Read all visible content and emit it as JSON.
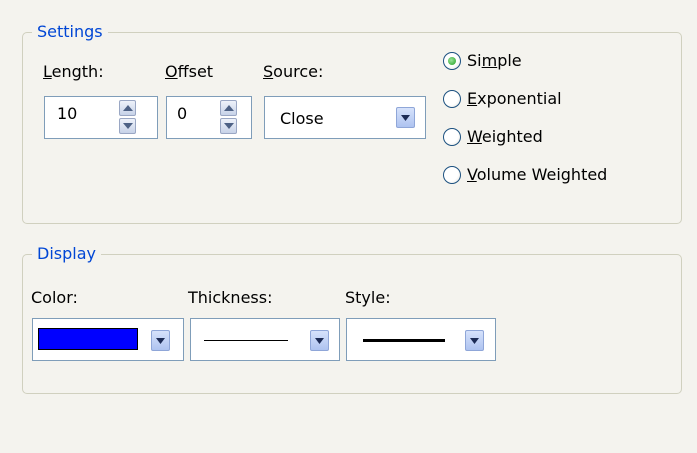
{
  "settings": {
    "title": "Settings",
    "length": {
      "label_pre": "",
      "label_mnemonic": "L",
      "label_post": "ength:",
      "value": "10"
    },
    "offset": {
      "label_pre": "",
      "label_mnemonic": "O",
      "label_post": "ffset",
      "value": "0"
    },
    "source": {
      "label_pre": "",
      "label_mnemonic": "S",
      "label_post": "ource:",
      "value": "Close"
    },
    "methods": [
      {
        "pre": "Si",
        "mnemonic": "m",
        "post": "ple",
        "selected": true
      },
      {
        "pre": "",
        "mnemonic": "E",
        "post": "xponential",
        "selected": false
      },
      {
        "pre": "",
        "mnemonic": "W",
        "post": "eighted",
        "selected": false
      },
      {
        "pre": "",
        "mnemonic": "V",
        "post": "olume Weighted",
        "selected": false
      }
    ]
  },
  "display": {
    "title": "Display",
    "color": {
      "label": "Color:",
      "value": "#0000ff"
    },
    "thickness": {
      "label": "Thickness:"
    },
    "style": {
      "label": "Style:"
    }
  },
  "colors": {
    "group_title": "#0046d5",
    "radio_selected": "#21a121"
  }
}
